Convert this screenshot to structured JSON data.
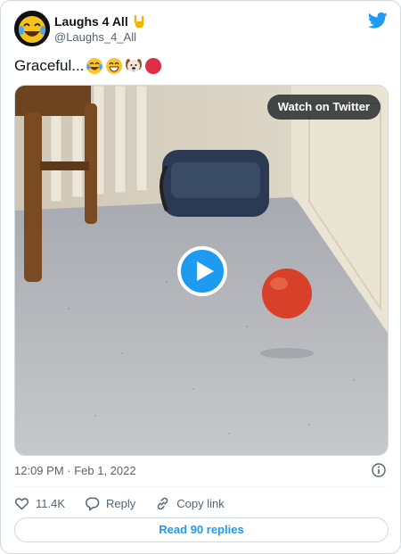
{
  "tweet": {
    "author": {
      "name": "Laughs 4 All",
      "handle": "@Laughs_4_All",
      "name_emoji": "hand-horns-icon"
    },
    "text": "Graceful...",
    "text_emojis": [
      "face-with-tears-of-joy-icon",
      "grinning-face-icon",
      "dog-face-icon",
      "red-circle-icon"
    ],
    "timestamp": "12:09 PM · Feb 1, 2022"
  },
  "media": {
    "watch_label": "Watch on Twitter",
    "play_icon": "play-icon"
  },
  "actions": {
    "like_count": "11.4K",
    "reply_label": "Reply",
    "copy_label": "Copy link"
  },
  "footer": {
    "read_replies_label": "Read 90 replies"
  },
  "colors": {
    "accent": "#1d9bf0",
    "secondary_text": "#536471",
    "border": "#cfd9de"
  }
}
